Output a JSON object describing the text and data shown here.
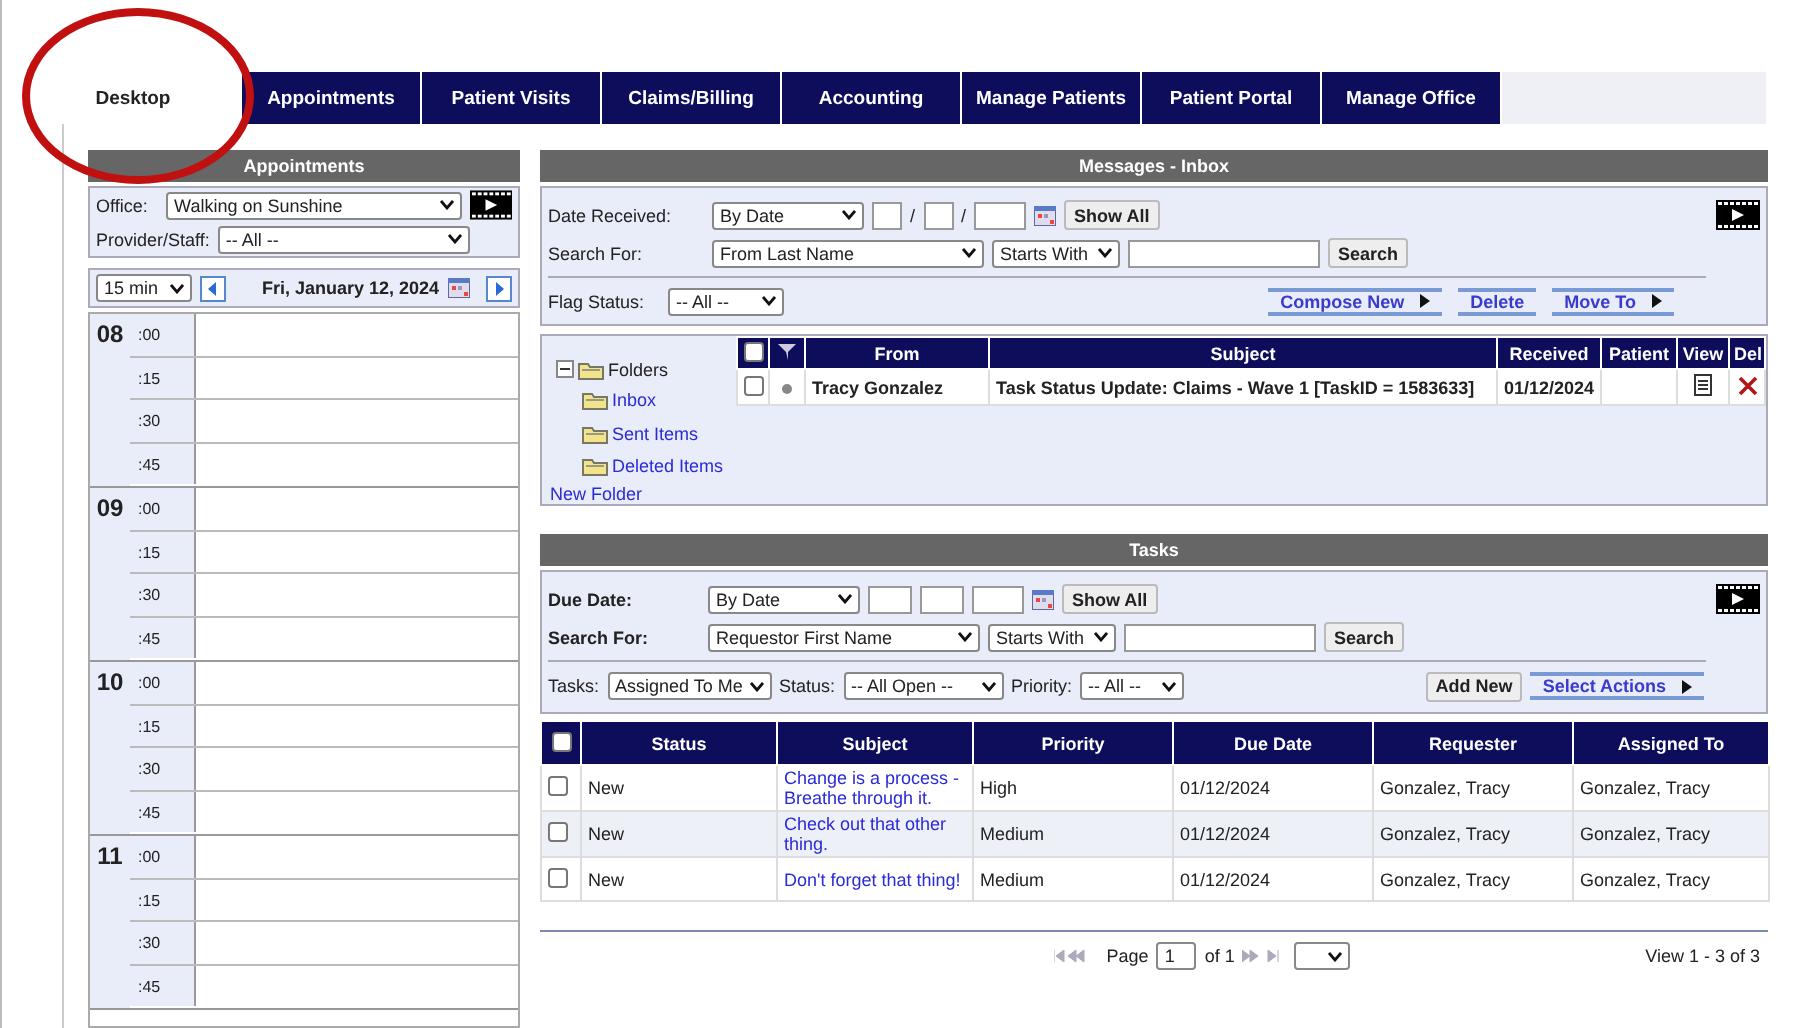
{
  "tabs": [
    {
      "label": "Desktop",
      "selected": true
    },
    {
      "label": "Appointments",
      "selected": false
    },
    {
      "label": "Patient Visits",
      "selected": false
    },
    {
      "label": "Claims/Billing",
      "selected": false
    },
    {
      "label": "Accounting",
      "selected": false
    },
    {
      "label": "Manage Patients",
      "selected": false
    },
    {
      "label": "Patient Portal",
      "selected": false
    },
    {
      "label": "Manage Office",
      "selected": false
    }
  ],
  "appointments": {
    "title": "Appointments",
    "office_label": "Office:",
    "office": "Walking on Sunshine",
    "provider_label": "Provider/Staff:",
    "provider": "-- All --",
    "interval": "15 min",
    "date": "Fri, January 12, 2024",
    "hours": [
      {
        "hour": "08",
        "slots": [
          ":00",
          ":15",
          ":30",
          ":45"
        ]
      },
      {
        "hour": "09",
        "slots": [
          ":00",
          ":15",
          ":30",
          ":45"
        ]
      },
      {
        "hour": "10",
        "slots": [
          ":00",
          ":15",
          ":30",
          ":45"
        ]
      },
      {
        "hour": "11",
        "slots": [
          ":00",
          ":15",
          ":30",
          ":45"
        ]
      }
    ]
  },
  "messages": {
    "title": "Messages - Inbox",
    "date_label": "Date Received:",
    "date_mode": "By Date",
    "date_separators": [
      "/",
      "/"
    ],
    "all_checked": false,
    "show_all": "Show All",
    "search_label": "Search For:",
    "search_field": "From Last Name",
    "match": "Starts With",
    "search_button": "Search",
    "flag_label": "Flag Status:",
    "flag": "-- All --",
    "actions": [
      {
        "label": "Compose New",
        "kind": "menu"
      },
      {
        "label": "Delete",
        "kind": "plain"
      },
      {
        "label": "Move To",
        "kind": "menu"
      }
    ],
    "folders": {
      "label": "Folders",
      "expanded": true,
      "children": [
        {
          "label": "Inbox"
        },
        {
          "label": "Sent Items"
        },
        {
          "label": "Deleted Items"
        }
      ]
    },
    "new_folder": "New Folder",
    "columns": [
      "From",
      "Subject",
      "Received",
      "Patient",
      "View",
      "Del"
    ],
    "rows": [
      {
        "checked": false,
        "from": "Tracy Gonzalez",
        "subject": "Task Status Update: Claims - Wave 1 [TaskID = 1583633]",
        "received": "01/12/2024"
      }
    ]
  },
  "tasks": {
    "title": "Tasks",
    "due_label": "Due Date:",
    "due_mode": "By Date",
    "all_checked": false,
    "show_all": "Show All",
    "search_label": "Search For:",
    "search_field": "Requestor First Name",
    "match": "Starts With",
    "search_button": "Search",
    "tasks_label": "Tasks:",
    "tasks_filter": "Assigned To Me",
    "status_label": "Status:",
    "status": "-- All Open --",
    "priority_label": "Priority:",
    "priority": "-- All --",
    "add_new": "Add New",
    "select_actions": "Select Actions",
    "columns": [
      "Status",
      "Subject",
      "Priority",
      "Due Date",
      "Requester",
      "Assigned To"
    ],
    "rows": [
      {
        "checked": false,
        "status": "New",
        "subject": "Change is a process - Breathe through it.",
        "priority": "High",
        "due": "01/12/2024",
        "requester": "Gonzalez, Tracy",
        "assigned": "Gonzalez, Tracy"
      },
      {
        "checked": false,
        "status": "New",
        "subject": "Check out that other thing.",
        "priority": "Medium",
        "due": "01/12/2024",
        "requester": "Gonzalez, Tracy",
        "assigned": "Gonzalez, Tracy"
      },
      {
        "checked": false,
        "status": "New",
        "subject": "Don't forget that thing!",
        "priority": "Medium",
        "due": "01/12/2024",
        "requester": "Gonzalez, Tracy",
        "assigned": "Gonzalez, Tracy"
      }
    ],
    "pager": {
      "page_label": "Page",
      "page": "1",
      "of": "of 1",
      "view": "View 1 - 3 of 3"
    }
  }
}
